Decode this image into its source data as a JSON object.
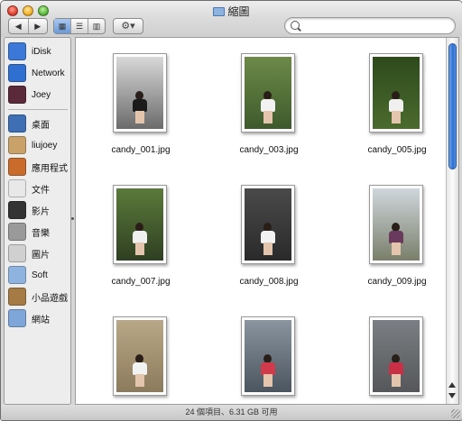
{
  "window": {
    "title": "縮圖"
  },
  "toolbar": {
    "back_glyph": "◀",
    "forward_glyph": "▶",
    "view_icon_glyph": "▦",
    "view_list_glyph": "☰",
    "view_column_glyph": "▥",
    "action_glyph": "⚙▾",
    "search_placeholder": ""
  },
  "sidebar": {
    "devices": [
      {
        "label": "iDisk",
        "icon": "idisk-icon",
        "color": "#3b78d8"
      },
      {
        "label": "Network",
        "icon": "network-globe-icon",
        "color": "#2f6fd0"
      },
      {
        "label": "Joey",
        "icon": "user-photo-icon",
        "color": "#5b2a3a"
      }
    ],
    "places": [
      {
        "label": "桌面",
        "icon": "desktop-icon",
        "color": "#3e6fb5"
      },
      {
        "label": "liujoey",
        "icon": "home-icon",
        "color": "#c9a26a"
      },
      {
        "label": "應用程式",
        "icon": "applications-icon",
        "color": "#c96b2a"
      },
      {
        "label": "文件",
        "icon": "documents-icon",
        "color": "#e8e8e8"
      },
      {
        "label": "影片",
        "icon": "movies-clapper-icon",
        "color": "#333333"
      },
      {
        "label": "音樂",
        "icon": "music-clef-icon",
        "color": "#9a9a9a"
      },
      {
        "label": "圖片",
        "icon": "pictures-icon",
        "color": "#d0d0d0"
      },
      {
        "label": "Soft",
        "icon": "folder-icon",
        "color": "#8fb3df"
      },
      {
        "label": "小品遊戲",
        "icon": "games-icon",
        "color": "#a57a45"
      },
      {
        "label": "網站",
        "icon": "sites-folder-icon",
        "color": "#7ea6d8"
      }
    ]
  },
  "files": [
    {
      "name": "candy_001.jpg",
      "bg": "#6b6b6b",
      "top": "#d8d8d8",
      "torso": "#1a1a1a"
    },
    {
      "name": "candy_003.jpg",
      "bg": "#3e5a2c",
      "top": "#6d8a48",
      "torso": "#f2f2f2"
    },
    {
      "name": "candy_005.jpg",
      "bg": "#4a6b2e",
      "top": "#2e4a1c",
      "torso": "#f0f0f0"
    },
    {
      "name": "candy_007.jpg",
      "bg": "#2f3f22",
      "top": "#5b7a3a",
      "torso": "#efefef"
    },
    {
      "name": "candy_008.jpg",
      "bg": "#2a2a2a",
      "top": "#4a4a4a",
      "torso": "#f2f2f2"
    },
    {
      "name": "candy_009.jpg",
      "bg": "#7a7f6a",
      "top": "#cfd7dd",
      "torso": "#6a3a5c"
    },
    {
      "name": "",
      "bg": "#8c7a5c",
      "top": "#b9a887",
      "torso": "#f2f2f2"
    },
    {
      "name": "",
      "bg": "#4a5560",
      "top": "#8a959f",
      "torso": "#d13a4a"
    },
    {
      "name": "",
      "bg": "#55575a",
      "top": "#7b7e82",
      "torso": "#c83048"
    }
  ],
  "status": {
    "text": "24 個項目、6.31 GB 可用"
  },
  "colors": {
    "selection_blue": "#2c6fd3",
    "sidebar_bg": "#ededed"
  }
}
